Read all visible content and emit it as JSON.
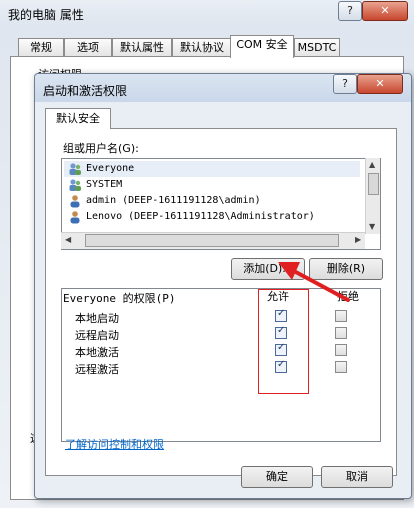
{
  "outer": {
    "title": "我的电脑 属性",
    "help_label": "?",
    "close_label": "✕",
    "tabs": [
      "常规",
      "选项",
      "默认属性",
      "默认协议",
      "COM 安全",
      "MSDTC"
    ],
    "section_label": "访问权限",
    "side_text": "这"
  },
  "dialog": {
    "title": "启动和激活权限",
    "help_label": "?",
    "close_label": "✕",
    "tab": "默认安全",
    "group_label": "组或用户名(G):",
    "users": [
      "Everyone",
      "SYSTEM",
      "admin (DEEP-1611191128\\admin)",
      "Lenovo (DEEP-1611191128\\Administrator)"
    ],
    "add_label": "添加(D)...",
    "remove_label": "删除(R)",
    "perm_header": "Everyone 的权限(P)",
    "allow_label": "允许",
    "deny_label": "拒绝",
    "permissions": [
      {
        "name": "本地启动",
        "allow": true,
        "deny": false
      },
      {
        "name": "远程启动",
        "allow": true,
        "deny": false
      },
      {
        "name": "本地激活",
        "allow": true,
        "deny": false
      },
      {
        "name": "远程激活",
        "allow": true,
        "deny": false
      }
    ],
    "link_label": "了解访问控制和权限",
    "ok_label": "确定",
    "cancel_label": "取消"
  },
  "colors": {
    "highlight": "#e02020",
    "link": "#0066cc",
    "title_bar": "#c9d7ea"
  }
}
